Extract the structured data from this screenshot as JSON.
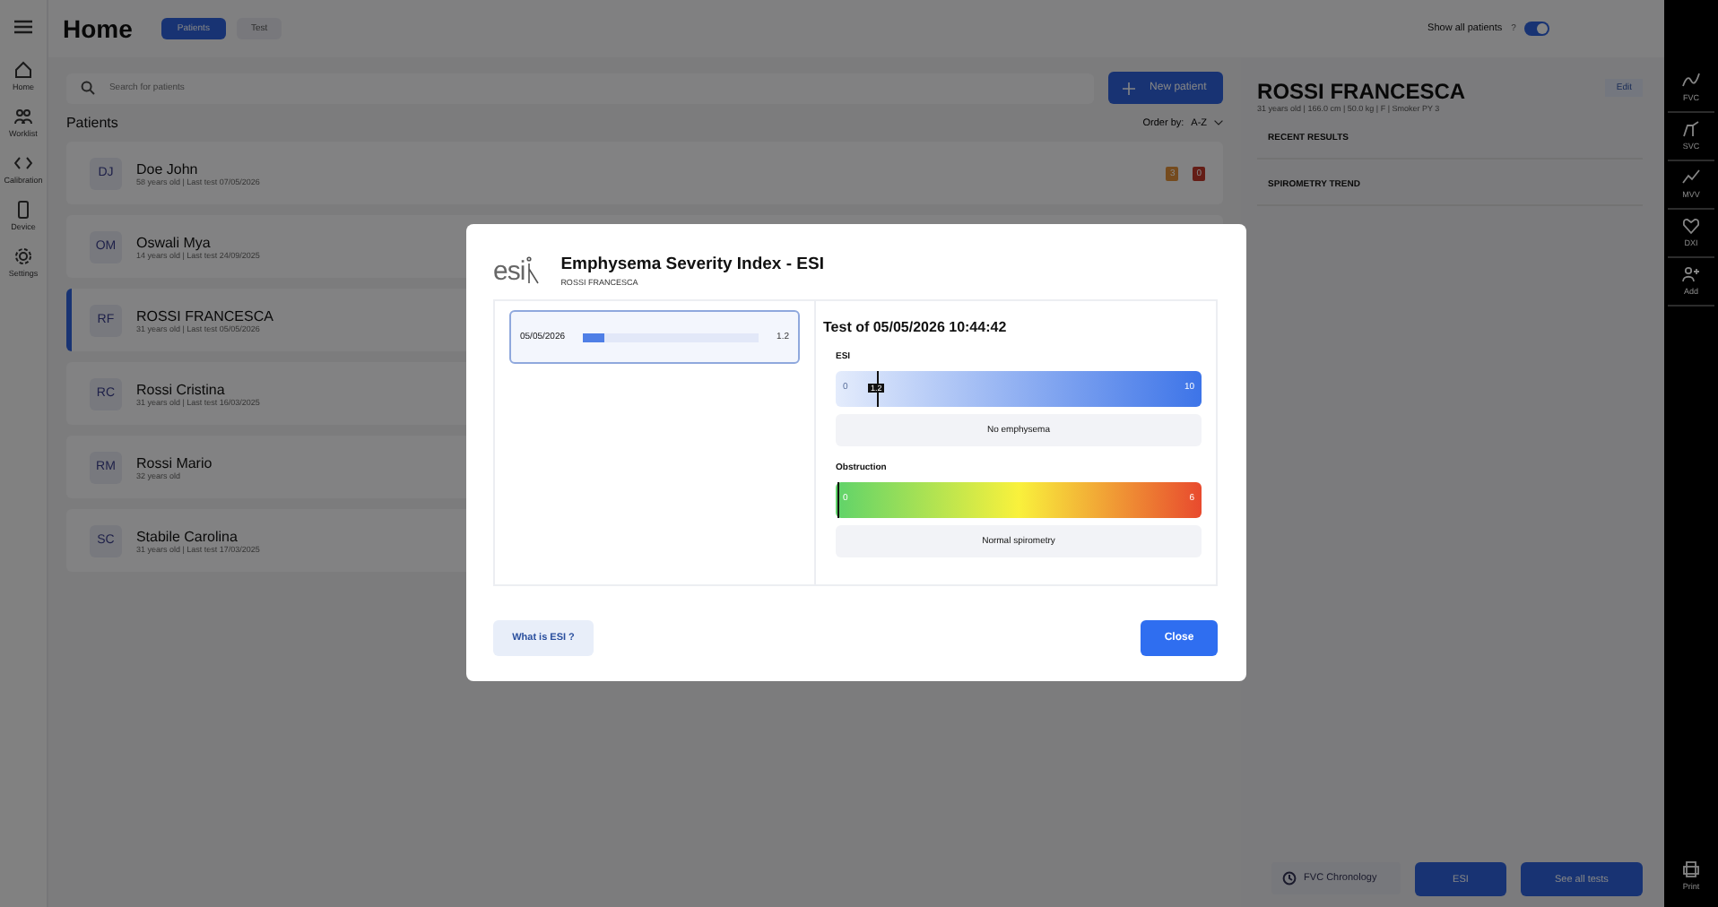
{
  "header": {
    "title": "Home",
    "tabs": [
      {
        "label": "Patients",
        "selected": true
      },
      {
        "label": "Test",
        "selected": false
      }
    ],
    "show_all": {
      "label": "Show all patients",
      "help": "?",
      "on": true
    }
  },
  "nav": [
    {
      "kind": "home",
      "label": "Home"
    },
    {
      "kind": "worklist",
      "label": "Worklist"
    },
    {
      "kind": "code",
      "label": "Calibration"
    },
    {
      "kind": "device",
      "label": "Device"
    },
    {
      "kind": "gear",
      "label": "Settings"
    }
  ],
  "search": {
    "placeholder": "Search for patients"
  },
  "new_patient": "New patient",
  "patients_title": "Patients",
  "order": {
    "label": "Order by:",
    "value": "A-Z"
  },
  "patients": [
    {
      "initials": "DJ",
      "name": "Doe John",
      "info": "58 years old | Last test 07/05/2026",
      "selected": false,
      "badges": [
        {
          "count": "3",
          "kind": "warning"
        },
        {
          "count": "0",
          "kind": "error"
        }
      ]
    },
    {
      "initials": "OM",
      "name": "Oswali Mya",
      "info": "14 years old | Last test 24/09/2025",
      "selected": false
    },
    {
      "initials": "RF",
      "name": "ROSSI FRANCESCA",
      "info": "31 years old | Last test 05/05/2026",
      "selected": true
    },
    {
      "initials": "RC",
      "name": "Rossi Cristina",
      "info": "31 years old | Last test 16/03/2025",
      "selected": false
    },
    {
      "initials": "RM",
      "name": "Rossi Mario",
      "info": "32 years old",
      "selected": false
    },
    {
      "initials": "SC",
      "name": "Stabile Carolina",
      "info": "31 years old | Last test 17/03/2025",
      "selected": false
    }
  ],
  "detail": {
    "name": "ROSSI FRANCESCA",
    "info": "31 years old | 166.0 cm | 50.0 kg | F | Smoker PY 3",
    "edit": "Edit",
    "sections": [
      "RECENT RESULTS",
      "SPIROMETRY TREND"
    ],
    "buttons": [
      {
        "kind": "history",
        "label": "FVC Chronology"
      },
      {
        "kind": "primary",
        "label": "ESI"
      },
      {
        "kind": "primary",
        "label": "See all tests"
      }
    ]
  },
  "tools": [
    {
      "kind": "wave",
      "label": "FVC"
    },
    {
      "kind": "step",
      "label": "SVC"
    },
    {
      "kind": "zigzag",
      "label": "MVV"
    },
    {
      "kind": "heart",
      "label": "DXI"
    },
    {
      "kind": "people",
      "label": "Add"
    },
    {
      "kind": "print",
      "label": "Print"
    }
  ],
  "modal": {
    "logo": "esi",
    "title": "Emphysema Severity Index - ESI",
    "patient": "ROSSI FRANCESCA",
    "history": [
      {
        "date": "05/05/2026",
        "level": 0.12,
        "value": "1.2",
        "selected": true
      }
    ],
    "test_title": "Test of 05/05/2026 10:44:42",
    "scales": [
      {
        "kind": "blue",
        "label": "ESI",
        "min": "0",
        "max": "10",
        "marker": "1.2",
        "level": 0.12,
        "result": "No emphysema"
      },
      {
        "kind": "traffic",
        "label": "Obstruction",
        "min": "0",
        "max": "6",
        "level": 0,
        "result": "Normal spirometry"
      }
    ],
    "help": "What is ESI ?",
    "close": "Close"
  }
}
